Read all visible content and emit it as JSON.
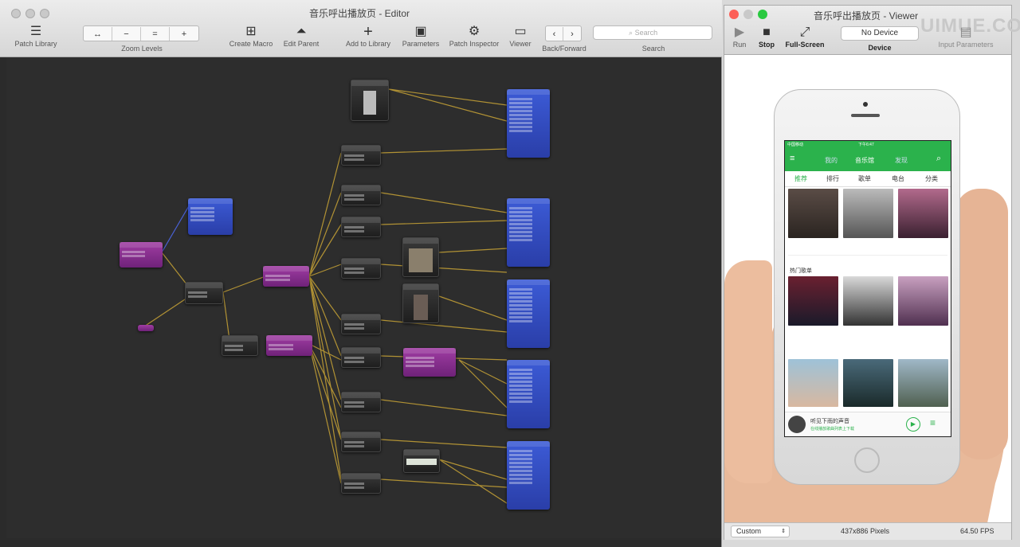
{
  "editor": {
    "title": "音乐呼出播放页 - Editor",
    "toolbar": {
      "patch_library": "Patch Library",
      "zoom_levels": "Zoom Levels",
      "zoom_buttons": [
        "↔",
        "−",
        "=",
        "+"
      ],
      "create_macro": "Create Macro",
      "edit_parent": "Edit Parent",
      "add_to_library": "Add to Library",
      "parameters": "Parameters",
      "patch_inspector": "Patch Inspector",
      "viewer": "Viewer",
      "back_forward": "Back/Forward",
      "search_label": "Search",
      "search_placeholder": "Search"
    }
  },
  "viewer": {
    "title": "音乐呼出播放页 - Viewer",
    "toolbar": {
      "run": "Run",
      "stop": "Stop",
      "full_screen": "Full-Screen",
      "device_value": "No Device",
      "device_label": "Device",
      "input_parameters": "Input Parameters"
    },
    "status": {
      "size_select": "Custom",
      "pixels": "437x886 Pixels",
      "fps": "64.50 FPS"
    }
  },
  "app": {
    "header_tabs": [
      "我的",
      "音乐馆",
      "发现"
    ],
    "sub_tabs": [
      "推荐",
      "排行",
      "歌单",
      "电台",
      "分类"
    ],
    "hot_section": "热门歌单",
    "now_playing": {
      "title": "听见下雨的声音",
      "subtitle": "在线播放歌曲列表上下载"
    },
    "status_time": "下午6:47",
    "carrier": "中国移动"
  },
  "watermark": "UIMUE.COM"
}
